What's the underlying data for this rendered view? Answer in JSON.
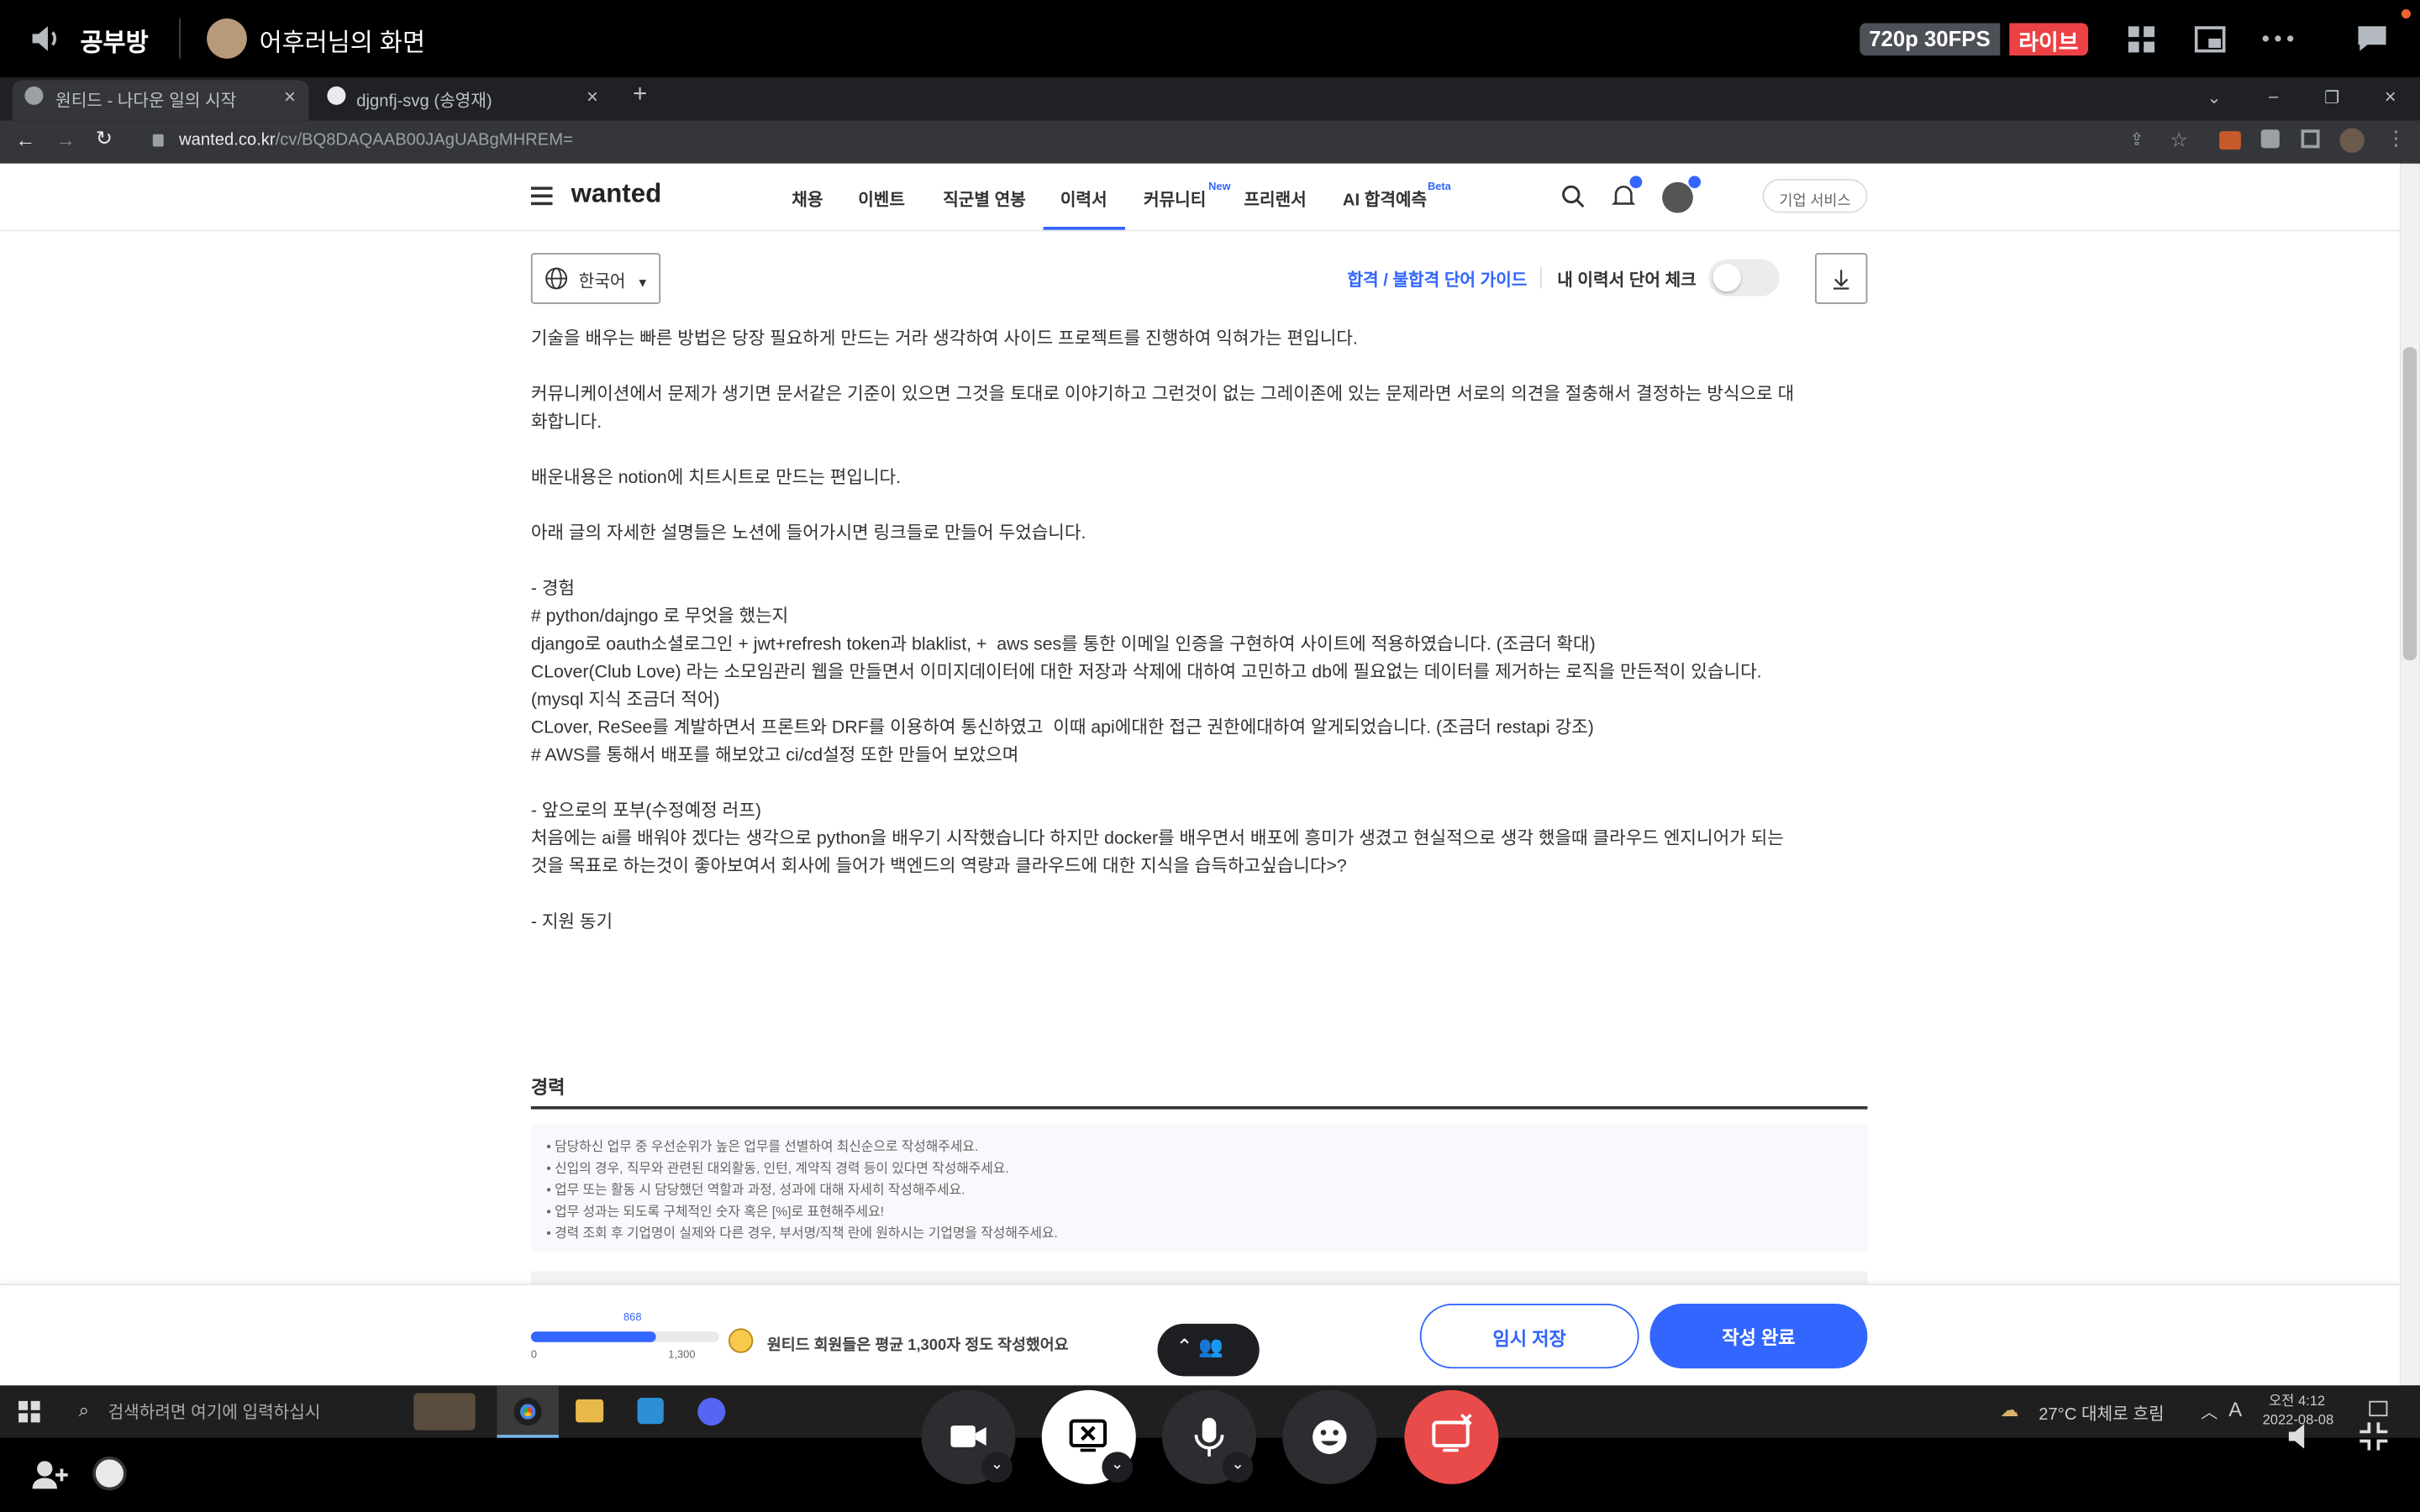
{
  "discord": {
    "channel": "공부방",
    "screen_owner": "어후러님의 화면",
    "quality": "720p 30FPS",
    "live": "라이브",
    "brand_red": "#ed4245",
    "stop_red": "#e94a4a"
  },
  "browser": {
    "tabs": [
      {
        "label": "원티드 - 나다운 일의 시작"
      },
      {
        "label": "djgnfj-svg (송영재)"
      }
    ],
    "url_host": "wanted.co.kr",
    "url_path": "/cv/BQ8DAQAAB00JAgUABgMHREM="
  },
  "wanted": {
    "logo": "wanted",
    "nav": [
      "채용",
      "이벤트",
      "직군별 연봉",
      "이력서",
      "커뮤니티",
      "프리랜서",
      "AI 합격예측"
    ],
    "nav_new": "New",
    "nav_beta": "Beta",
    "enterprise": "기업 서비스",
    "language": "한국어",
    "guide_link": "합격 / 불합격 단어 가이드",
    "word_check": "내 이력서 단어 체크",
    "accent": "#3366ff"
  },
  "resume": {
    "lines": [
      "기술을 배우는 빠른 방법은 당장 필요하게 만드는 거라 생각하여 사이드 프로젝트를 진행하여 익혀가는 편입니다.",
      "",
      "커뮤니케이션에서 문제가 생기면 문서같은 기준이 있으면 그것을 토대로 이야기하고 그런것이 없는 그레이존에 있는 문제라면 서로의 의견을 절충해서 결정하는 방식으로 대",
      "화합니다.",
      "",
      "배운내용은 notion에 치트시트로 만드는 편입니다.",
      "",
      "아래 글의 자세한 설명들은 노션에 들어가시면 링크들로 만들어 두었습니다.",
      "",
      "- 경험",
      "# python/dajngo 로 무엇을 했는지",
      "django로 oauth소셜로그인 + jwt+refresh token과 blaklist, +  aws ses를 통한 이메일 인증을 구현하여 사이트에 적용하였습니다. (조금더 확대)",
      "CLover(Club Love) 라는 소모임관리 웹을 만들면서 이미지데이터에 대한 저장과 삭제에 대하여 고민하고 db에 필요없는 데이터를 제거하는 로직을 만든적이 있습니다.",
      "(mysql 지식 조금더 적어)",
      "CLover, ReSee를 계발하면서 프론트와 DRF를 이용하여 통신하였고  이때 api에대한 접근 권한에대하여 알게되었습니다. (조금더 restapi 강조)",
      "# AWS를 통해서 배포를 해보았고 ci/cd설정 또한 만들어 보았으며",
      "",
      "- 앞으로의 포부(수정예정 러프)",
      "처음에는 ai를 배워야 겠다는 생각으로 python을 배우기 시작했습니다 하지만 docker를 배우면서 배포에 흥미가 생겼고 현실적으로 생각 했을때 클라우드 엔지니어가 되는",
      "것을 목표로 하는것이 좋아보여서 회사에 들어가 백엔드의 역량과 클라우드에 대한 지식을 습득하고싶습니다>?",
      "",
      "- 지원 동기"
    ],
    "career_title": "경력",
    "tips": [
      "• 담당하신 업무 중 우선순위가 높은 업무를 선별하여 최신순으로 작성해주세요.",
      "• 신입의 경우, 직무와 관련된 대외활동, 인턴, 계약직 경력 등이 있다면 작성해주세요.",
      "• 업무 또는 활동 시 담당했던 역할과 과정, 성과에 대해 자세히 작성해주세요.",
      "• 업무 성과는 되도록 구체적인 숫자 혹은 [%]로 표현해주세요!",
      "• 경력 조회 후 기업명이 실제와 다른 경우, 부서명/직책 란에 원하시는 기업명을 작성해주세요."
    ]
  },
  "footer": {
    "progress_value": 868,
    "progress_max": 1300,
    "progress_min_label": "0",
    "progress_max_label": "1,300",
    "progress_current_label": "868",
    "hint": "원티드 회원들은 평균 1,300자 정도 작성했어요",
    "temp_save": "임시 저장",
    "complete": "작성 완료"
  },
  "taskbar": {
    "search_placeholder": "검색하려면 여기에 입력하십시",
    "weather": "27°C  대체로 흐림",
    "ime": "A",
    "time": "오전 4:12",
    "date": "2022-08-08"
  }
}
